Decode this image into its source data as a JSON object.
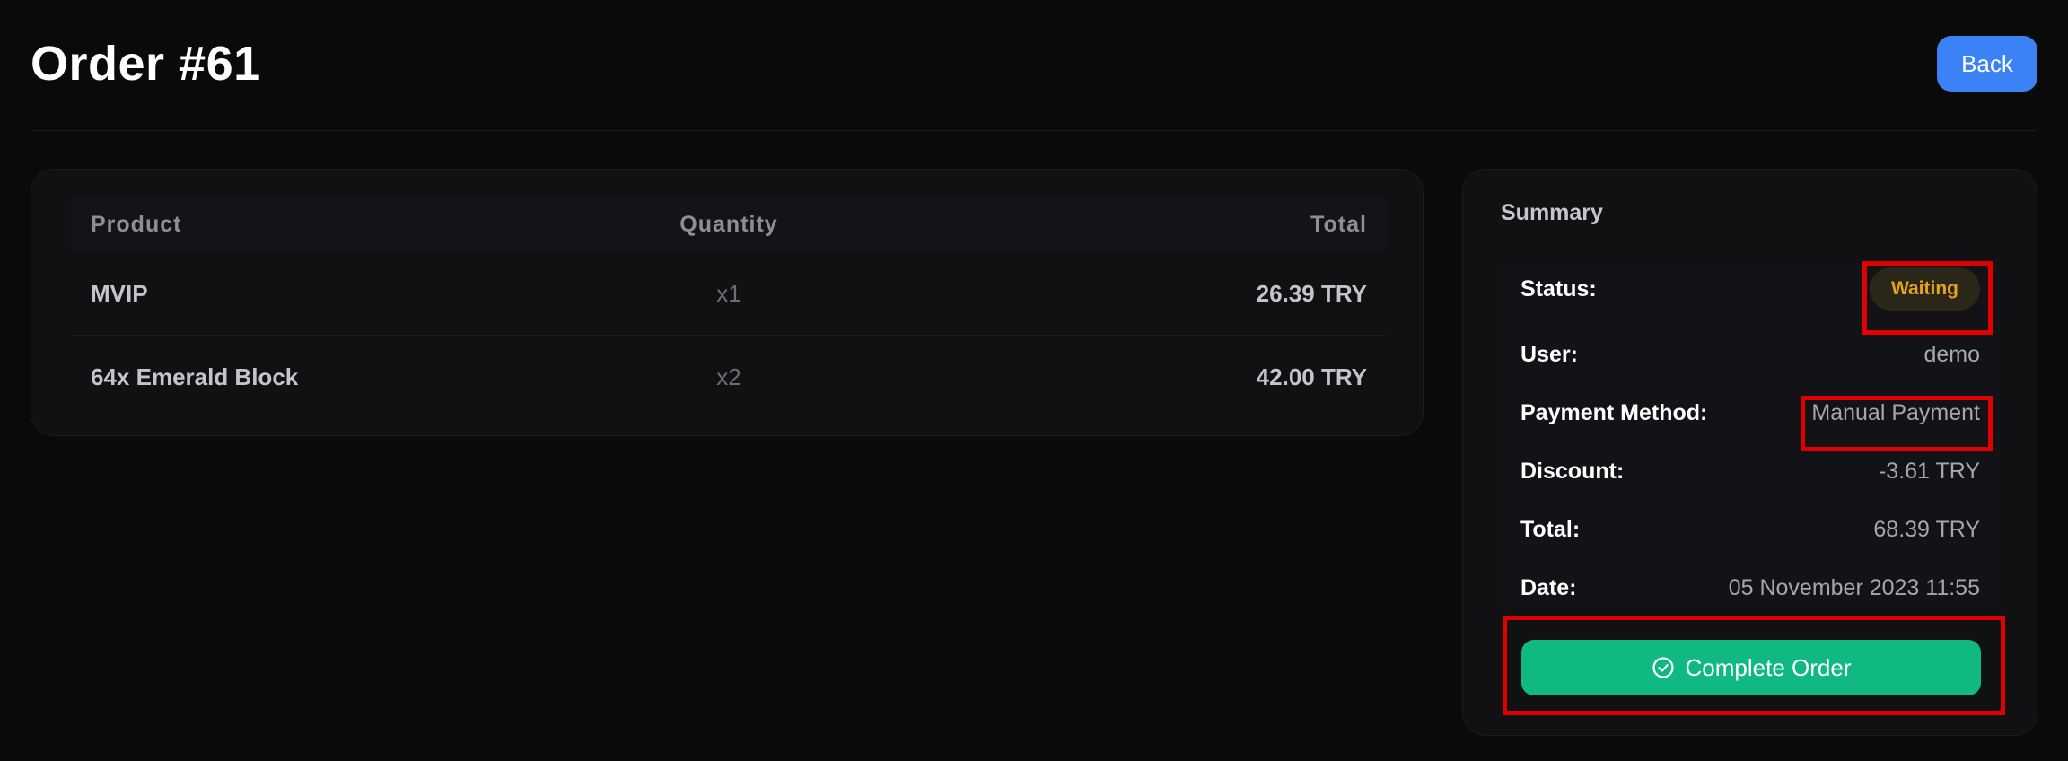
{
  "page": {
    "title": "Order #61",
    "back_label": "Back"
  },
  "products": {
    "headers": {
      "product": "Product",
      "quantity": "Quantity",
      "total": "Total"
    },
    "rows": [
      {
        "product": "MVIP",
        "quantity": "x1",
        "total": "26.39 TRY"
      },
      {
        "product": "64x Emerald Block",
        "quantity": "x2",
        "total": "42.00 TRY"
      }
    ]
  },
  "summary": {
    "title": "Summary",
    "status_label": "Status:",
    "status_value": "Waiting",
    "user_label": "User:",
    "user_value": "demo",
    "payment_label": "Payment Method:",
    "payment_value": "Manual Payment",
    "discount_label": "Discount:",
    "discount_value": "-3.61 TRY",
    "total_label": "Total:",
    "total_value": "68.39 TRY",
    "date_label": "Date:",
    "date_value": "05 November 2023 11:55",
    "complete_label": "Complete Order",
    "complete_icon": "check-circle-icon"
  },
  "colors": {
    "background": "#0a0a0b",
    "card": "#111114",
    "accent_blue": "#3b82f6",
    "accent_green": "#10b981",
    "status_waiting": "#e6a31c",
    "highlight": "#e00000"
  }
}
